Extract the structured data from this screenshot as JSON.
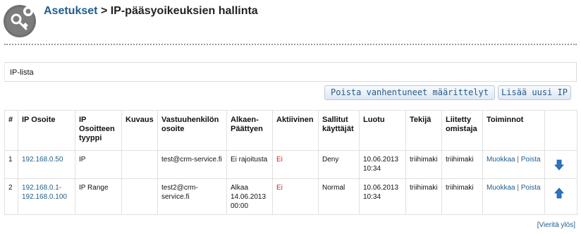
{
  "header": {
    "breadcrumb_link": "Asetukset",
    "separator": ">",
    "page_title": "IP-pääsyoikeuksien hallinta"
  },
  "section": {
    "title": "IP-lista"
  },
  "toolbar": {
    "delete_expired_label": "Poista vanhentuneet määrittelyt",
    "add_new_label": "Lisää uusi IP"
  },
  "table": {
    "columns": [
      "#",
      "IP Osoite",
      "IP Osoitteen tyyppi",
      "Kuvaus",
      "Vastuuhenkilön osoite",
      "Alkaen-Päättyen",
      "Aktiivinen",
      "Sallitut käyttäjät",
      "Luotu",
      "Tekijä",
      "Liitetty omistaja",
      "Toiminnot"
    ],
    "rows": [
      {
        "num": "1",
        "ip": "192.168.0.50",
        "type": "IP",
        "description": "",
        "contact": "test@crm-service.fi",
        "period": "Ei rajoitusta",
        "active": "Ei",
        "allowed": "Deny",
        "created": "10.06.2013 10:34",
        "author": "triihimaki",
        "owner": "triihimaki",
        "edit": "Muokkaa",
        "action_sep": "|",
        "delete": "Poista",
        "move_icon": "arrow-down-icon"
      },
      {
        "num": "2",
        "ip": "192.168.0.1-192.168.0.100",
        "type": "IP Range",
        "description": "",
        "contact": "test2@crm-service.fi",
        "period": "Alkaa 14.06.2013 00:00",
        "active": "Ei",
        "allowed": "Normal",
        "created": "10.06.2013 10:34",
        "author": "triihimaki",
        "owner": "triihimaki",
        "edit": "Muokkaa",
        "action_sep": "|",
        "delete": "Poista",
        "move_icon": "arrow-up-icon"
      }
    ]
  },
  "footer": {
    "scroll_top_label": "[Vieritä ylös]"
  },
  "colors": {
    "link": "#1f5d8c",
    "inactive_red": "#cc2222",
    "arrow_blue": "#2a74c4"
  }
}
